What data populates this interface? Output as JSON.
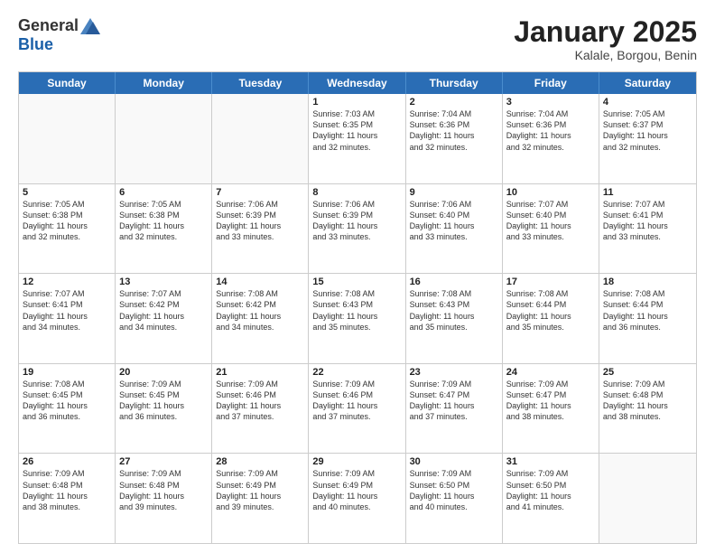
{
  "logo": {
    "general": "General",
    "blue": "Blue"
  },
  "title": "January 2025",
  "location": "Kalale, Borgou, Benin",
  "days": [
    "Sunday",
    "Monday",
    "Tuesday",
    "Wednesday",
    "Thursday",
    "Friday",
    "Saturday"
  ],
  "rows": [
    [
      {
        "num": "",
        "lines": [],
        "empty": true
      },
      {
        "num": "",
        "lines": [],
        "empty": true
      },
      {
        "num": "",
        "lines": [],
        "empty": true
      },
      {
        "num": "1",
        "lines": [
          "Sunrise: 7:03 AM",
          "Sunset: 6:35 PM",
          "Daylight: 11 hours",
          "and 32 minutes."
        ]
      },
      {
        "num": "2",
        "lines": [
          "Sunrise: 7:04 AM",
          "Sunset: 6:36 PM",
          "Daylight: 11 hours",
          "and 32 minutes."
        ]
      },
      {
        "num": "3",
        "lines": [
          "Sunrise: 7:04 AM",
          "Sunset: 6:36 PM",
          "Daylight: 11 hours",
          "and 32 minutes."
        ]
      },
      {
        "num": "4",
        "lines": [
          "Sunrise: 7:05 AM",
          "Sunset: 6:37 PM",
          "Daylight: 11 hours",
          "and 32 minutes."
        ]
      }
    ],
    [
      {
        "num": "5",
        "lines": [
          "Sunrise: 7:05 AM",
          "Sunset: 6:38 PM",
          "Daylight: 11 hours",
          "and 32 minutes."
        ]
      },
      {
        "num": "6",
        "lines": [
          "Sunrise: 7:05 AM",
          "Sunset: 6:38 PM",
          "Daylight: 11 hours",
          "and 32 minutes."
        ]
      },
      {
        "num": "7",
        "lines": [
          "Sunrise: 7:06 AM",
          "Sunset: 6:39 PM",
          "Daylight: 11 hours",
          "and 33 minutes."
        ]
      },
      {
        "num": "8",
        "lines": [
          "Sunrise: 7:06 AM",
          "Sunset: 6:39 PM",
          "Daylight: 11 hours",
          "and 33 minutes."
        ]
      },
      {
        "num": "9",
        "lines": [
          "Sunrise: 7:06 AM",
          "Sunset: 6:40 PM",
          "Daylight: 11 hours",
          "and 33 minutes."
        ]
      },
      {
        "num": "10",
        "lines": [
          "Sunrise: 7:07 AM",
          "Sunset: 6:40 PM",
          "Daylight: 11 hours",
          "and 33 minutes."
        ]
      },
      {
        "num": "11",
        "lines": [
          "Sunrise: 7:07 AM",
          "Sunset: 6:41 PM",
          "Daylight: 11 hours",
          "and 33 minutes."
        ]
      }
    ],
    [
      {
        "num": "12",
        "lines": [
          "Sunrise: 7:07 AM",
          "Sunset: 6:41 PM",
          "Daylight: 11 hours",
          "and 34 minutes."
        ]
      },
      {
        "num": "13",
        "lines": [
          "Sunrise: 7:07 AM",
          "Sunset: 6:42 PM",
          "Daylight: 11 hours",
          "and 34 minutes."
        ]
      },
      {
        "num": "14",
        "lines": [
          "Sunrise: 7:08 AM",
          "Sunset: 6:42 PM",
          "Daylight: 11 hours",
          "and 34 minutes."
        ]
      },
      {
        "num": "15",
        "lines": [
          "Sunrise: 7:08 AM",
          "Sunset: 6:43 PM",
          "Daylight: 11 hours",
          "and 35 minutes."
        ]
      },
      {
        "num": "16",
        "lines": [
          "Sunrise: 7:08 AM",
          "Sunset: 6:43 PM",
          "Daylight: 11 hours",
          "and 35 minutes."
        ]
      },
      {
        "num": "17",
        "lines": [
          "Sunrise: 7:08 AM",
          "Sunset: 6:44 PM",
          "Daylight: 11 hours",
          "and 35 minutes."
        ]
      },
      {
        "num": "18",
        "lines": [
          "Sunrise: 7:08 AM",
          "Sunset: 6:44 PM",
          "Daylight: 11 hours",
          "and 36 minutes."
        ]
      }
    ],
    [
      {
        "num": "19",
        "lines": [
          "Sunrise: 7:08 AM",
          "Sunset: 6:45 PM",
          "Daylight: 11 hours",
          "and 36 minutes."
        ]
      },
      {
        "num": "20",
        "lines": [
          "Sunrise: 7:09 AM",
          "Sunset: 6:45 PM",
          "Daylight: 11 hours",
          "and 36 minutes."
        ]
      },
      {
        "num": "21",
        "lines": [
          "Sunrise: 7:09 AM",
          "Sunset: 6:46 PM",
          "Daylight: 11 hours",
          "and 37 minutes."
        ]
      },
      {
        "num": "22",
        "lines": [
          "Sunrise: 7:09 AM",
          "Sunset: 6:46 PM",
          "Daylight: 11 hours",
          "and 37 minutes."
        ]
      },
      {
        "num": "23",
        "lines": [
          "Sunrise: 7:09 AM",
          "Sunset: 6:47 PM",
          "Daylight: 11 hours",
          "and 37 minutes."
        ]
      },
      {
        "num": "24",
        "lines": [
          "Sunrise: 7:09 AM",
          "Sunset: 6:47 PM",
          "Daylight: 11 hours",
          "and 38 minutes."
        ]
      },
      {
        "num": "25",
        "lines": [
          "Sunrise: 7:09 AM",
          "Sunset: 6:48 PM",
          "Daylight: 11 hours",
          "and 38 minutes."
        ]
      }
    ],
    [
      {
        "num": "26",
        "lines": [
          "Sunrise: 7:09 AM",
          "Sunset: 6:48 PM",
          "Daylight: 11 hours",
          "and 38 minutes."
        ]
      },
      {
        "num": "27",
        "lines": [
          "Sunrise: 7:09 AM",
          "Sunset: 6:48 PM",
          "Daylight: 11 hours",
          "and 39 minutes."
        ]
      },
      {
        "num": "28",
        "lines": [
          "Sunrise: 7:09 AM",
          "Sunset: 6:49 PM",
          "Daylight: 11 hours",
          "and 39 minutes."
        ]
      },
      {
        "num": "29",
        "lines": [
          "Sunrise: 7:09 AM",
          "Sunset: 6:49 PM",
          "Daylight: 11 hours",
          "and 40 minutes."
        ]
      },
      {
        "num": "30",
        "lines": [
          "Sunrise: 7:09 AM",
          "Sunset: 6:50 PM",
          "Daylight: 11 hours",
          "and 40 minutes."
        ]
      },
      {
        "num": "31",
        "lines": [
          "Sunrise: 7:09 AM",
          "Sunset: 6:50 PM",
          "Daylight: 11 hours",
          "and 41 minutes."
        ]
      },
      {
        "num": "",
        "lines": [],
        "empty": true
      }
    ]
  ]
}
